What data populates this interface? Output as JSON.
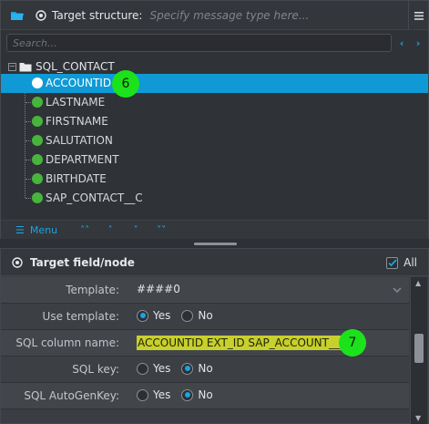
{
  "target_structure": {
    "title": "Target structure:",
    "placeholder": "Specify message type here...",
    "search_placeholder": "Search...",
    "root_label": "SQL_CONTACT",
    "nodes": [
      {
        "label": "ACCOUNTID",
        "selected": true
      },
      {
        "label": "LASTNAME"
      },
      {
        "label": "FIRSTNAME"
      },
      {
        "label": "SALUTATION"
      },
      {
        "label": "DEPARTMENT"
      },
      {
        "label": "BIRTHDATE"
      },
      {
        "label": "SAP_CONTACT__C"
      }
    ],
    "badge_6": "6",
    "toolbar": {
      "menu_label": "Menu"
    }
  },
  "target_field": {
    "title": "Target field/node",
    "all_label": "All",
    "all_checked": true,
    "rows": {
      "template_label": "Template:",
      "template_value": "####0",
      "use_template_label": "Use template:",
      "use_template_yes": "Yes",
      "use_template_no": "No",
      "sql_column_label": "SQL column name:",
      "sql_column_value": "ACCOUNTID EXT_ID SAP_ACCOUNT__C",
      "sql_key_label": "SQL key:",
      "sql_key_yes": "Yes",
      "sql_key_no": "No",
      "sql_autogen_label": "SQL AutoGenKey:",
      "sql_autogen_yes": "Yes",
      "sql_autogen_no": "No"
    },
    "badge_7": "7"
  },
  "colors": {
    "selection": "#0f9ad6",
    "node_dot": "#47b53c",
    "badge": "#1ce21c",
    "accent": "#1aa4e0",
    "highlight": "#c7d02c"
  }
}
